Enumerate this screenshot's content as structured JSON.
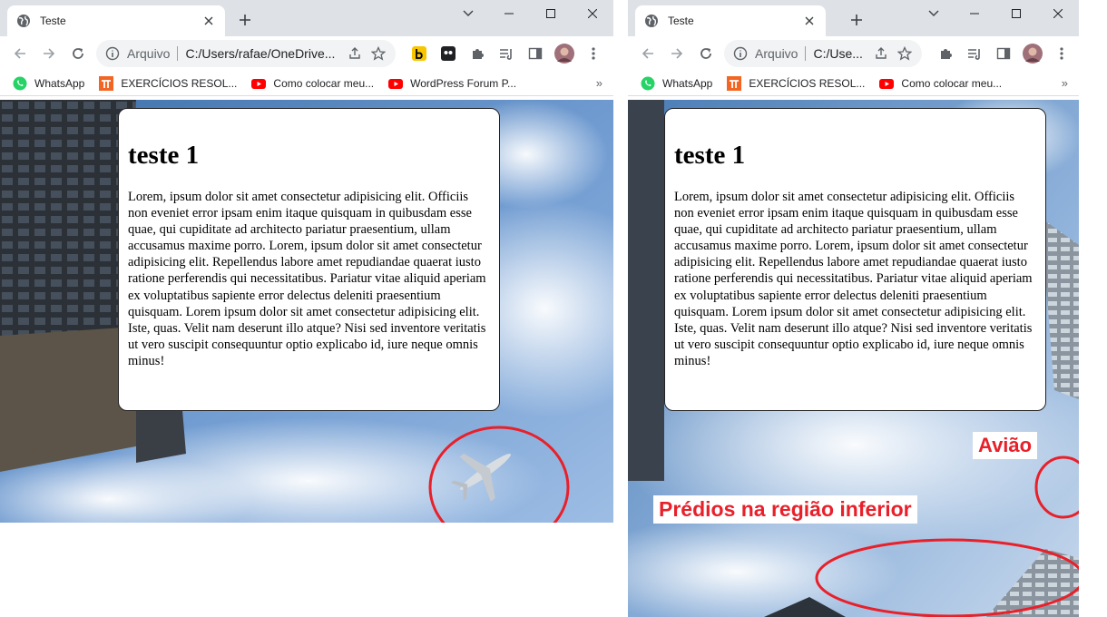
{
  "left": {
    "tab": {
      "title": "Teste"
    },
    "address": {
      "scheme": "Arquivo",
      "url": "C:/Users/rafae/OneDrive..."
    },
    "bookmarks": [
      "WhatsApp",
      "EXERCÍCIOS RESOL...",
      "Como colocar meu...",
      "WordPress Forum P..."
    ],
    "card": {
      "heading": "teste 1",
      "body": "Lorem, ipsum dolor sit amet consectetur adipisicing elit. Officiis non eveniet error ipsam enim itaque quisquam in quibusdam esse quae, qui cupiditate ad architecto pariatur praesentium, ullam accusamus maxime porro. Lorem, ipsum dolor sit amet consectetur adipisicing elit. Repellendus labore amet repudiandae quaerat iusto ratione perferendis qui necessitatibus. Pariatur vitae aliquid aperiam ex voluptatibus sapiente error delectus deleniti praesentium quisquam. Lorem ipsum dolor sit amet consectetur adipisicing elit. Iste, quas. Velit nam deserunt illo atque? Nisi sed inventore veritatis ut vero suscipit consequuntur optio explicabo id, iure neque omnis minus!"
    }
  },
  "right": {
    "tab": {
      "title": "Teste"
    },
    "address": {
      "scheme": "Arquivo",
      "url": "C:/Use..."
    },
    "bookmarks": [
      "WhatsApp",
      "EXERCÍCIOS RESOL...",
      "Como colocar meu..."
    ],
    "card": {
      "heading": "teste 1",
      "body": "Lorem, ipsum dolor sit amet consectetur adipisicing elit. Officiis non eveniet error ipsam enim itaque quisquam in quibusdam esse quae, qui cupiditate ad architecto pariatur praesentium, ullam accusamus maxime porro. Lorem, ipsum dolor sit amet consectetur adipisicing elit. Repellendus labore amet repudiandae quaerat iusto ratione perferendis qui necessitatibus. Pariatur vitae aliquid aperiam ex voluptatibus sapiente error delectus deleniti praesentium quisquam. Lorem ipsum dolor sit amet consectetur adipisicing elit. Iste, quas. Velit nam deserunt illo atque? Nisi sed inventore veritatis ut vero suscipit consequuntur optio explicabo id, iure neque omnis minus!"
    },
    "annotations": {
      "plane_label": "Avião",
      "buildings_label": "Prédios na região inferior"
    }
  },
  "colors": {
    "annotation_red": "#e8202a",
    "tabbar": "#dee1e6",
    "omnibox": "#f1f3f4",
    "sky": "#5b8fc7"
  },
  "icons": [
    "globe-icon",
    "close-icon",
    "plus-icon",
    "minimize-icon",
    "maximize-icon",
    "window-close-icon",
    "back-icon",
    "forward-icon",
    "reload-icon",
    "info-icon",
    "share-icon",
    "star-icon",
    "extensions-icon",
    "reading-list-icon",
    "side-panel-icon",
    "profile-avatar",
    "kebab-menu-icon",
    "whatsapp-icon",
    "pi-icon",
    "youtube-icon"
  ]
}
